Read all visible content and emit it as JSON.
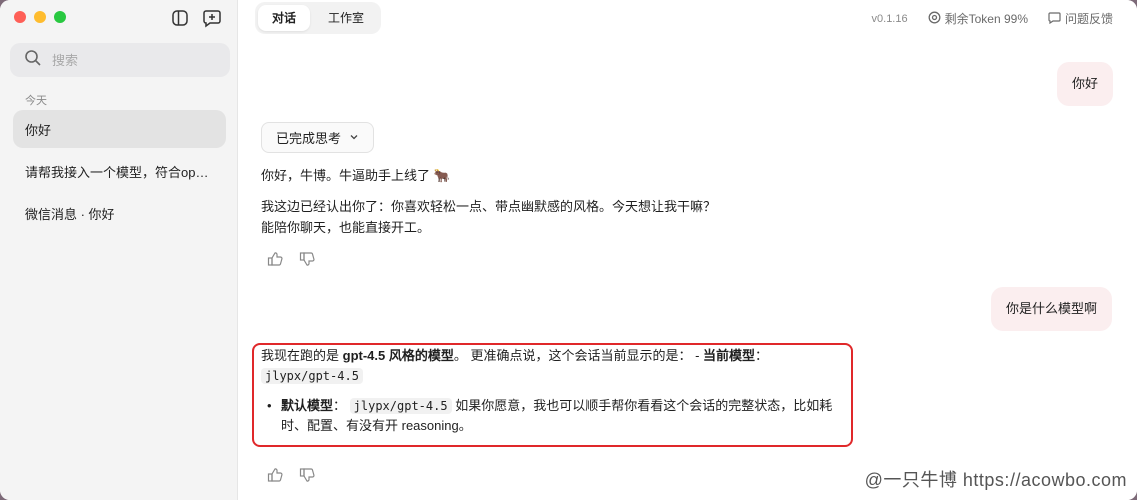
{
  "sidebar": {
    "search_placeholder": "搜索",
    "section_today": "今天",
    "conversations": [
      {
        "title": "你好",
        "active": true
      },
      {
        "title": "请帮我接入一个模型，符合op…",
        "active": false
      },
      {
        "title": "微信消息 · 你好",
        "active": false
      }
    ]
  },
  "header": {
    "tabs": [
      {
        "label": "对话",
        "active": true
      },
      {
        "label": "工作室",
        "active": false
      }
    ],
    "version": "v0.1.16",
    "token_label": "剩余Token 99%",
    "feedback_label": "问题反馈"
  },
  "chat": {
    "user_msg_1": "你好",
    "thinking_label": "已完成思考",
    "reply_1_line1": "你好，牛博。牛逼助手上线了 🐂",
    "reply_1_line2": "我这边已经认出你了：你喜欢轻松一点、带点幽默感的风格。今天想让我干嘛？",
    "reply_1_line3": "能陪你聊天，也能直接开工。",
    "user_msg_2": "你是什么模型啊",
    "reply_2": {
      "p1_a": "我现在跑的是 ",
      "p1_bold": "gpt-4.5 风格的模型",
      "p1_b": "。 更准确点说，这个会话当前显示的是： - ",
      "p1_bold2": "当前模型",
      "p1_c": "：",
      "code_model": "jlypx/gpt-4.5",
      "bullet_bold": "默认模型",
      "bullet_colon": "：",
      "bullet_code": "jlypx/gpt-4.5",
      "bullet_rest": " 如果你愿意，我也可以顺手帮你看看这个会话的完整状态，比如耗时、配置、有没有开 reasoning。"
    }
  },
  "watermark": "@一只牛博 https://acowbo.com",
  "colors": {
    "highlight_border": "#e0282a",
    "user_bubble": "#fbeeef"
  }
}
